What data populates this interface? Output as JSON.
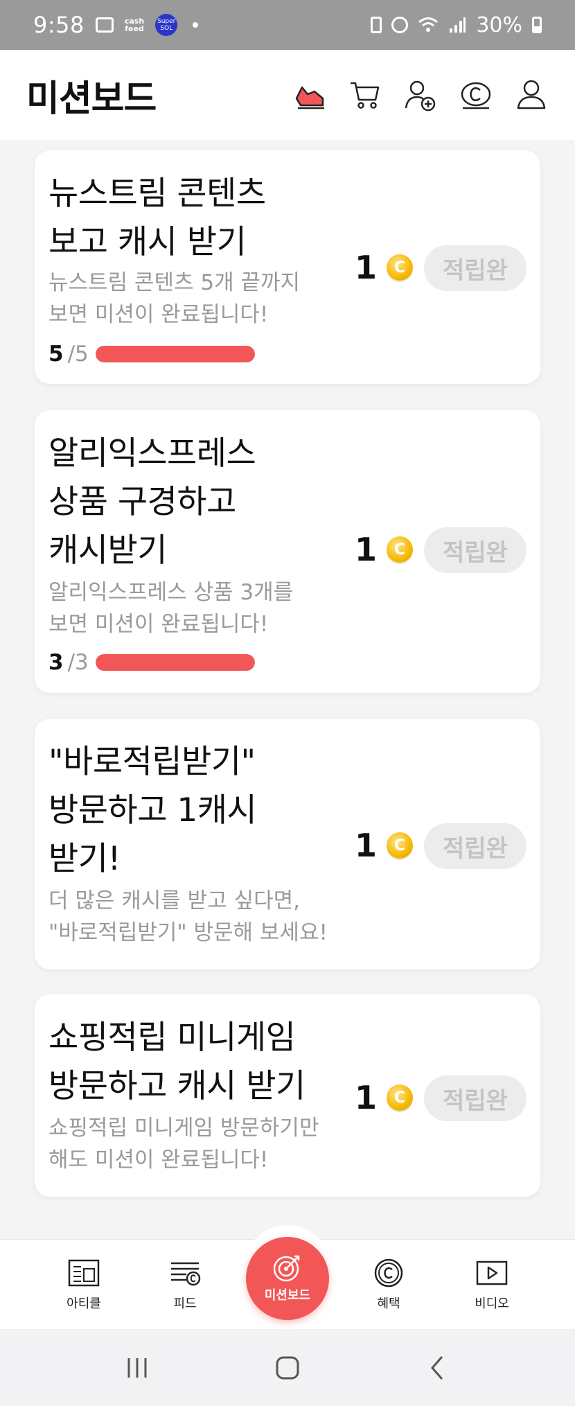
{
  "status_bar": {
    "time": "9:58",
    "cash_feed_label": "cash\nfeed",
    "super_sol_label": "Super\nSOL",
    "battery_text": "30%"
  },
  "header": {
    "title": "미션보드",
    "icons": [
      "sneaker-icon",
      "cart-icon",
      "add-friend-icon",
      "cash-coin-icon",
      "profile-icon"
    ]
  },
  "missions": [
    {
      "title": "뉴스트림 콘텐츠\n보고 캐시 받기",
      "description": "뉴스트림 콘텐츠 5개 끝까지\n보면 미션이 완료됩니다!",
      "progress_done": "5",
      "progress_total": "/5",
      "progress_fraction": 1.0,
      "reward": "1",
      "coin_symbol": "C",
      "status": "적립완"
    },
    {
      "title": "알리익스프레스\n상품 구경하고\n캐시받기",
      "description": "알리익스프레스 상품 3개를\n보면 미션이 완료됩니다!",
      "progress_done": "3",
      "progress_total": "/3",
      "progress_fraction": 1.0,
      "reward": "1",
      "coin_symbol": "C",
      "status": "적립완"
    },
    {
      "title": "\"바로적립받기\"\n방문하고 1캐시\n받기!",
      "description": "더 많은 캐시를 받고 싶다면,\n\"바로적립받기\" 방문해 보세요!",
      "reward": "1",
      "coin_symbol": "C",
      "status": "적립완"
    },
    {
      "title": "쇼핑적립 미니게임\n방문하고 캐시 받기",
      "description": "쇼핑적립 미니게임 방문하기만\n해도 미션이 완료됩니다!",
      "reward": "1",
      "coin_symbol": "C",
      "status": "적립완"
    }
  ],
  "bottom_nav": {
    "items": [
      {
        "label": "아티클",
        "icon": "article-icon"
      },
      {
        "label": "피드",
        "icon": "feed-icon"
      },
      {
        "label": "미션보드",
        "icon": "target-icon",
        "active": true
      },
      {
        "label": "혜택",
        "icon": "benefit-coin-icon"
      },
      {
        "label": "비디오",
        "icon": "video-icon"
      }
    ]
  },
  "colors": {
    "accent": "#f35656",
    "coin": "#f6b800",
    "muted_text": "#9a9a9a",
    "pill_bg": "#ececec"
  }
}
